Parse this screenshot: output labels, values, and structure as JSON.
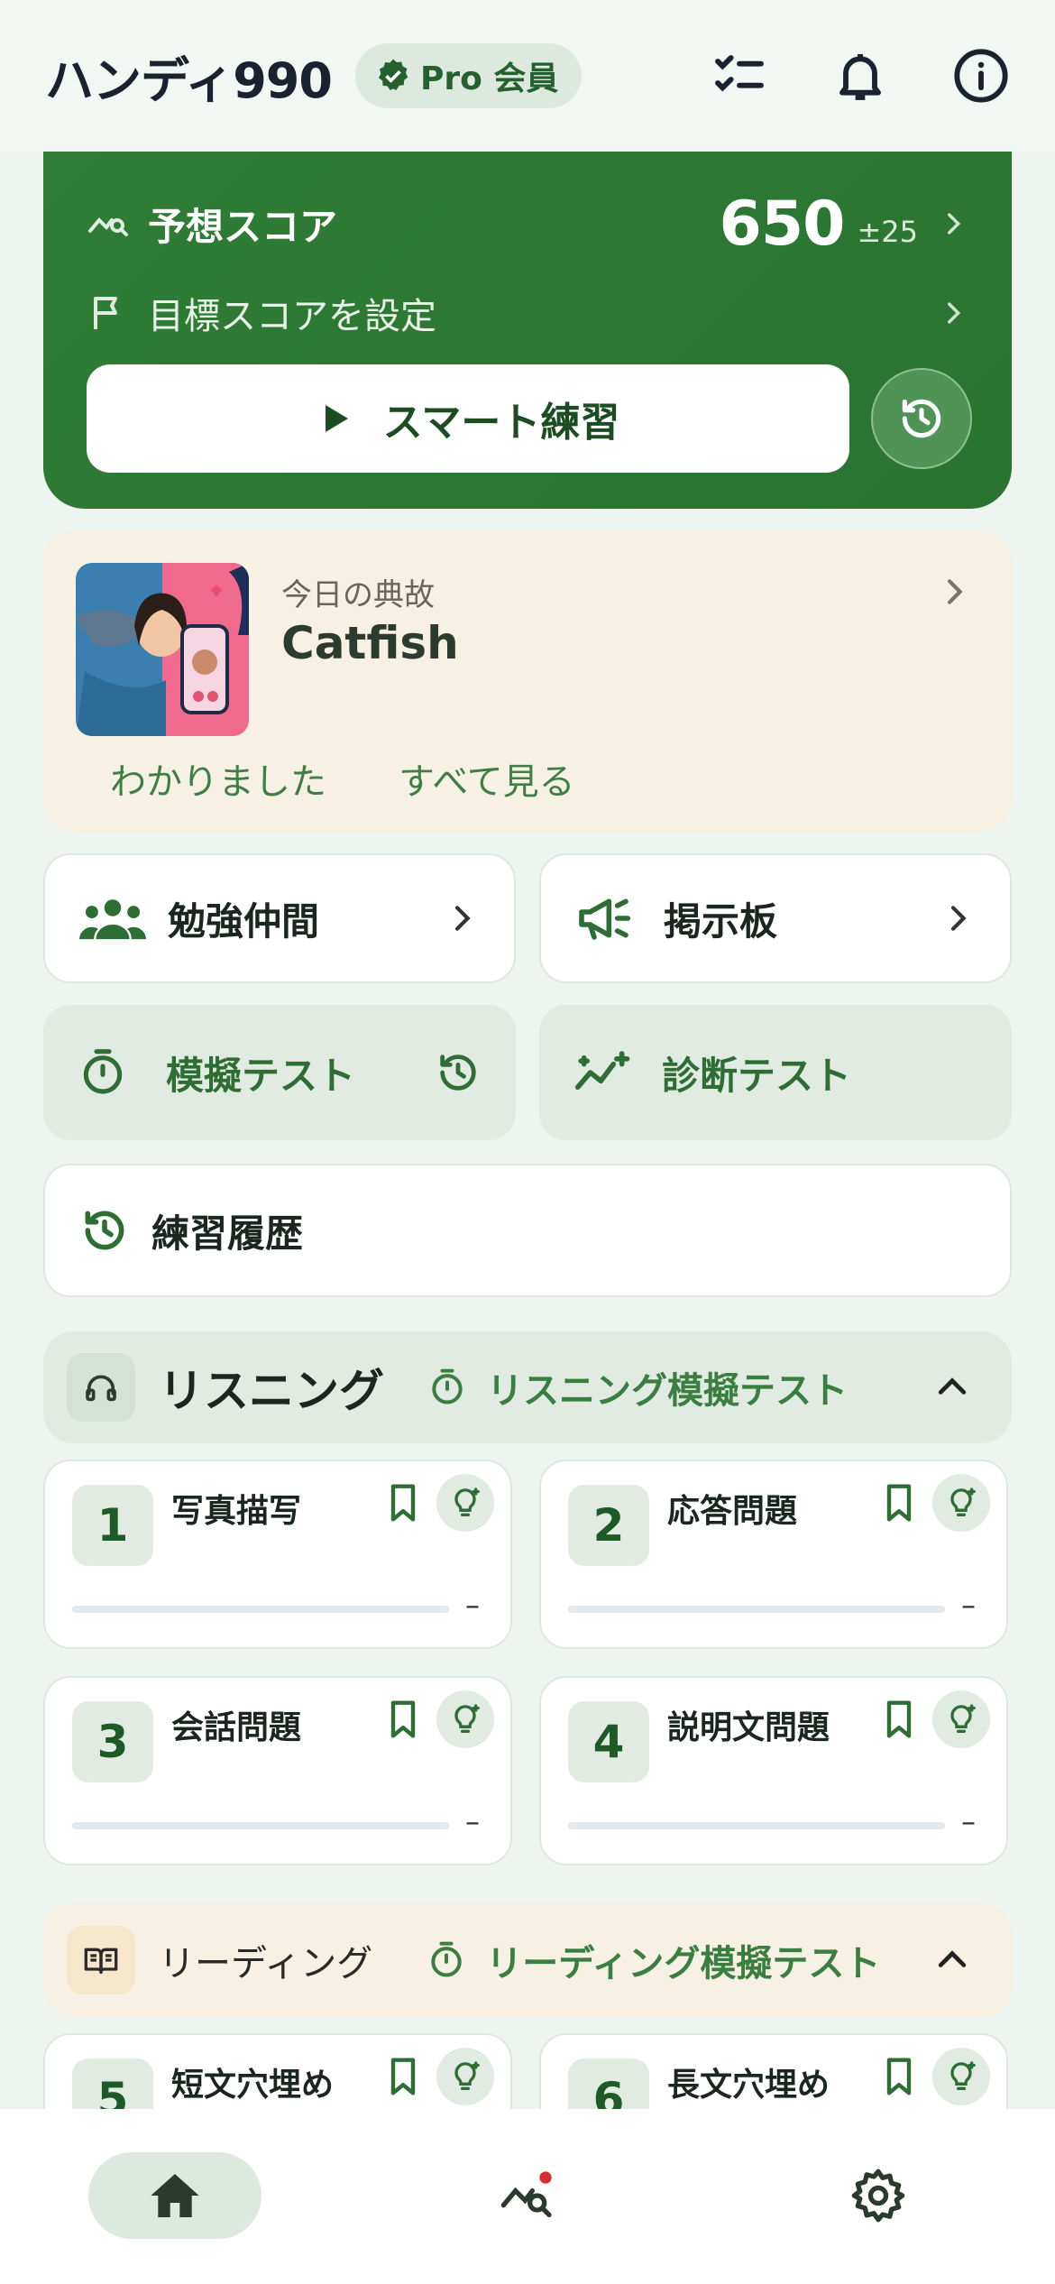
{
  "header": {
    "app_title": "ハンディ990",
    "pro_badge": "Pro 会員",
    "icons": [
      "checklist-icon",
      "bell-icon",
      "info-icon"
    ]
  },
  "score_card": {
    "predicted_label": "予想スコア",
    "predicted_value": "650",
    "predicted_margin": "±25",
    "target_label": "目標スコアを設定",
    "smart_practice_label": "スマート練習",
    "accent_color": "#2f7d36"
  },
  "idiom": {
    "caption": "今日の典故",
    "word": "Catfish",
    "understood_label": "わかりました",
    "see_all_label": "すべて見る"
  },
  "tiles": {
    "study_buddy": "勉強仲間",
    "bulletin": "掲示板",
    "mock_test": "模擬テスト",
    "diagnostic_test": "診断テスト",
    "practice_history": "練習履歴"
  },
  "listening": {
    "title": "リスニング",
    "mock_label": "リスニング模擬テスト",
    "parts": [
      {
        "num": "1",
        "title": "写真描写",
        "progress": "–"
      },
      {
        "num": "2",
        "title": "応答問題",
        "progress": "–"
      },
      {
        "num": "3",
        "title": "会話問題",
        "progress": "–"
      },
      {
        "num": "4",
        "title": "説明文問題",
        "progress": "–"
      }
    ]
  },
  "reading": {
    "title": "リーディング",
    "mock_label": "リーディング模擬テスト",
    "parts": [
      {
        "num": "5",
        "title": "短文穴埋め"
      },
      {
        "num": "6",
        "title": "長文穴埋め"
      }
    ]
  },
  "bottom_nav": {
    "items": [
      "home-icon",
      "analysis-icon",
      "settings-icon"
    ],
    "active": "home",
    "notification_dot_color": "#d32f2f"
  }
}
